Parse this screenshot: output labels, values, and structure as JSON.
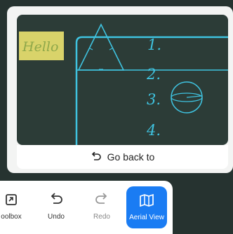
{
  "preview": {
    "sticky_note_text": "Hello",
    "handwritten_numbers": [
      "1.",
      "2.",
      "3.",
      "4."
    ]
  },
  "go_back": {
    "label": "Go back to"
  },
  "toolbar": {
    "items": [
      {
        "label": "oolbox",
        "icon": "toolbox-icon"
      },
      {
        "label": "Undo",
        "icon": "undo-icon"
      },
      {
        "label": "Redo",
        "icon": "redo-icon"
      },
      {
        "label": "Aerial View",
        "icon": "map-icon",
        "active": true
      }
    ]
  },
  "colors": {
    "board": "#2c3c37",
    "accent": "#1a7cf3",
    "ink": "#3fc3e0",
    "sticky": "#d9d36a"
  }
}
